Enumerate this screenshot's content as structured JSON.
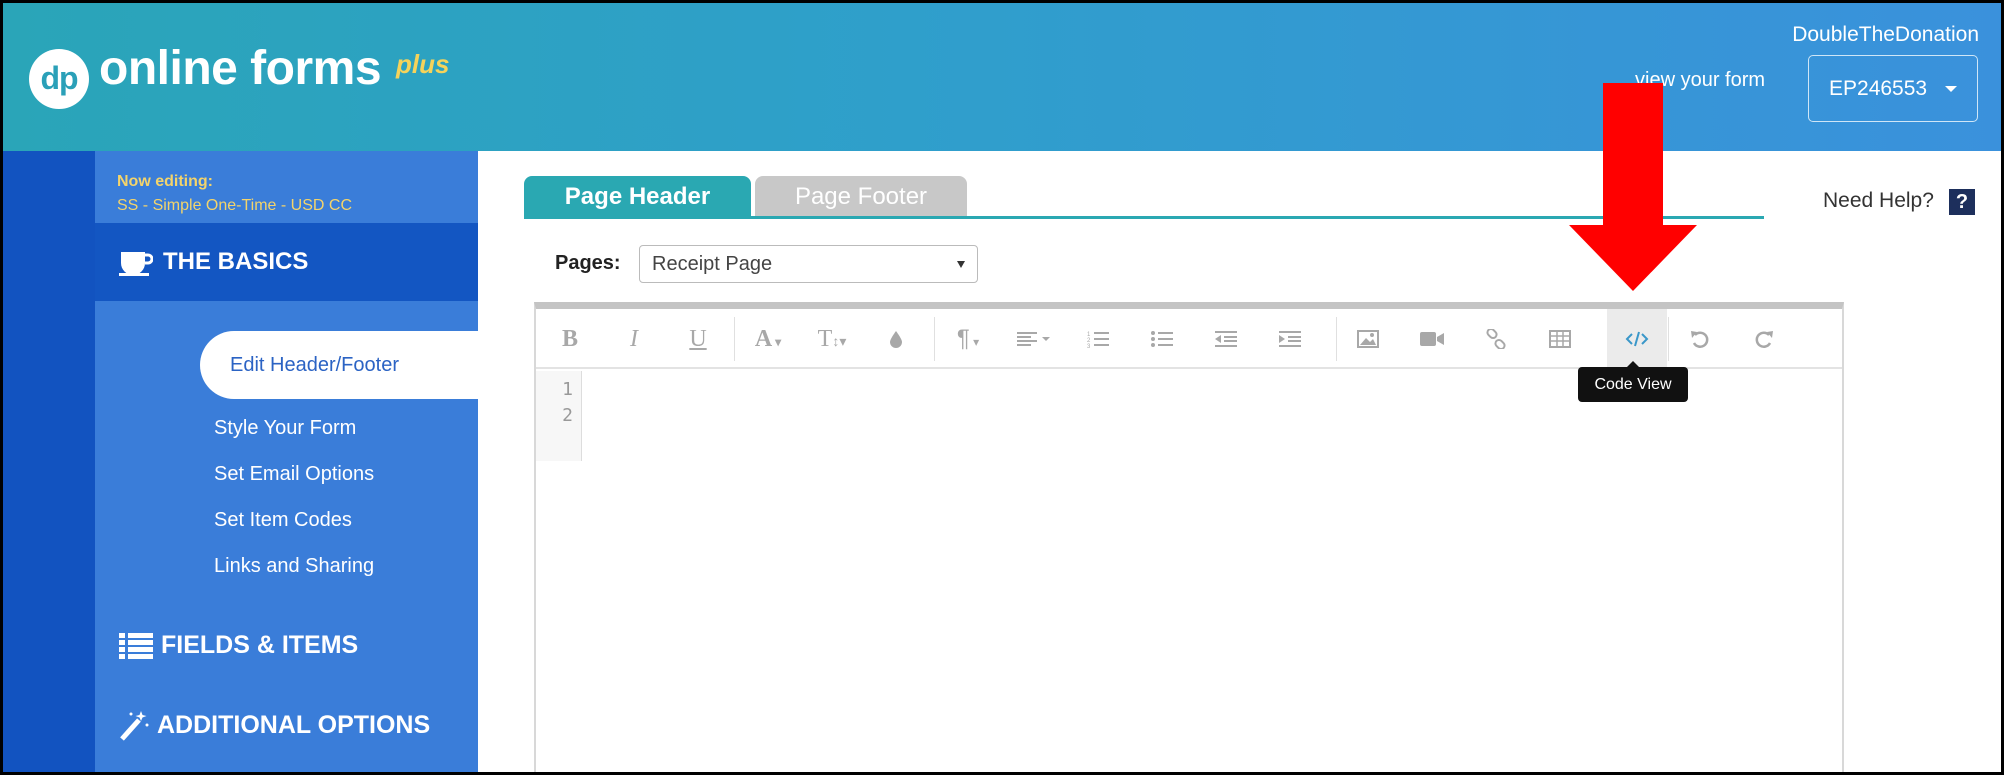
{
  "header": {
    "logo_mark": "dp",
    "logo_text": "online forms",
    "logo_suffix": "plus",
    "org_name": "DoubleTheDonation",
    "view_form_label": "view your form",
    "form_id": "EP246553"
  },
  "sidebar": {
    "now_editing_label": "Now editing:",
    "editing_name": "SS - Simple One-Time - USD CC",
    "basics_label": "THE BASICS",
    "basics_items": [
      {
        "label": "Edit Header/Footer",
        "active": true
      },
      {
        "label": "Style Your Form"
      },
      {
        "label": "Set Email Options"
      },
      {
        "label": "Set Item Codes"
      },
      {
        "label": "Links and Sharing"
      }
    ],
    "fields_label": "FIELDS & ITEMS",
    "additional_label": "ADDITIONAL OPTIONS"
  },
  "main": {
    "tabs": [
      {
        "label": "Page Header",
        "active": true
      },
      {
        "label": "Page Footer",
        "active": false
      }
    ],
    "need_help_label": "Need Help?",
    "help_icon_glyph": "?",
    "pages_label": "Pages:",
    "pages_selected": "Receipt Page",
    "editor": {
      "toolbar": [
        {
          "icon": "bold-icon",
          "glyph": "B"
        },
        {
          "icon": "italic-icon",
          "glyph": "I"
        },
        {
          "icon": "underline-icon",
          "glyph": "U"
        },
        {
          "icon": "font-family-icon",
          "glyph": "A"
        },
        {
          "icon": "font-size-icon",
          "glyph": "T"
        },
        {
          "icon": "color-icon"
        },
        {
          "icon": "paragraph-icon",
          "glyph": "¶"
        },
        {
          "icon": "align-icon"
        },
        {
          "icon": "ordered-list-icon"
        },
        {
          "icon": "unordered-list-icon"
        },
        {
          "icon": "outdent-icon"
        },
        {
          "icon": "indent-icon"
        },
        {
          "icon": "image-icon"
        },
        {
          "icon": "video-icon"
        },
        {
          "icon": "link-icon"
        },
        {
          "icon": "table-icon"
        },
        {
          "icon": "code-view-icon",
          "active": true
        },
        {
          "icon": "undo-icon"
        },
        {
          "icon": "redo-icon"
        }
      ],
      "line_numbers": [
        "1",
        "2"
      ],
      "tooltip": "Code View"
    }
  },
  "colors": {
    "accent_teal": "#2aa8b2",
    "sidebar_blue": "#3a7dd9",
    "sidebar_dark": "#1356c2",
    "highlight_yellow": "#f3d46b",
    "annotation_arrow": "#ff0000"
  }
}
